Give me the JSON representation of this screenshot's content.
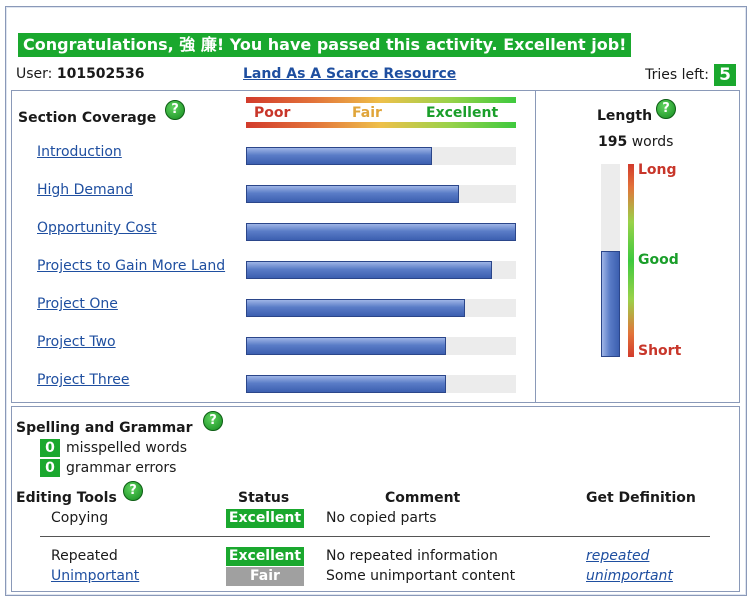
{
  "banner": "Congratulations, 強 廉! You have passed this activity.  Excellent job!",
  "user": {
    "label": "User:",
    "id": "101502536"
  },
  "activity_title": "Land As A Scarce Resource",
  "tries": {
    "label": "Tries left:",
    "value": "5"
  },
  "help_glyph": "?",
  "coverage": {
    "title": "Section Coverage",
    "scale": {
      "poor": "Poor",
      "fair": "Fair",
      "excellent": "Excellent"
    },
    "sections": [
      {
        "label": "Introduction",
        "coverage": 0.69
      },
      {
        "label": "High Demand",
        "coverage": 0.79
      },
      {
        "label": "Opportunity Cost",
        "coverage": 1.0
      },
      {
        "label": "Projects to Gain More Land",
        "coverage": 0.91
      },
      {
        "label": "Project One",
        "coverage": 0.81
      },
      {
        "label": "Project Two",
        "coverage": 0.74
      },
      {
        "label": "Project Three",
        "coverage": 0.74
      }
    ]
  },
  "length": {
    "title": "Length",
    "count": "195",
    "unit": "words",
    "level": 0.55,
    "labels": {
      "long": "Long",
      "good": "Good",
      "short": "Short"
    }
  },
  "spelling": {
    "title": "Spelling and Grammar",
    "misspelled_count": "0",
    "misspelled_label": "misspelled words",
    "grammar_count": "0",
    "grammar_label": "grammar errors"
  },
  "editing": {
    "title": "Editing Tools",
    "columns": {
      "status": "Status",
      "comment": "Comment",
      "definition": "Get Definition"
    },
    "rows": [
      {
        "tool": "Copying",
        "status": "Excellent",
        "comment": "No copied parts",
        "definition": ""
      },
      {
        "tool": "Repeated",
        "status": "Excellent",
        "comment": "No repeated information",
        "definition": "repeated"
      },
      {
        "tool": "Unimportant",
        "status": "Fair",
        "comment": "Some unimportant content",
        "definition": "unimportant"
      }
    ]
  },
  "colors": {
    "accent_green": "#1aa82e",
    "link_blue": "#1f4fa0",
    "fair_gray": "#a0a0a0",
    "poor_red": "#c8362a",
    "fair_orange": "#e0a53a",
    "excellent_green": "#1a9e2a"
  }
}
